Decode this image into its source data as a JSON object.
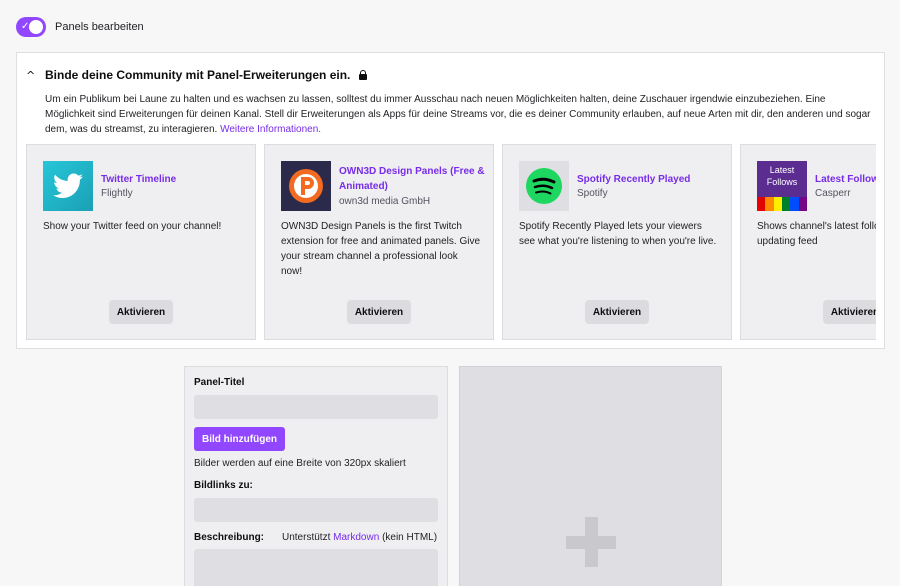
{
  "toggle": {
    "label": "Panels bearbeiten",
    "on": true
  },
  "extensions_box": {
    "title": "Binde deine Community mit Panel-Erweiterungen ein.",
    "description": "Um ein Publikum bei Laune zu halten und es wachsen zu lassen, solltest du immer Ausschau nach neuen Möglichkeiten halten, deine Zuschauer irgendwie einzubeziehen. Eine Möglichkeit sind Erweiterungen für deinen Kanal. Stell dir Erweiterungen als Apps für deine Streams vor, die es deiner Community erlauben, auf neue Arten mit dir, den anderen und sogar dem, was du streamst, zu interagieren.",
    "more_link": "Weitere Informationen.",
    "cards": [
      {
        "name": "Twitter Timeline",
        "developer": "Flightly",
        "description": "Show your Twitter feed on your channel!",
        "button": "Aktivieren",
        "icon": "twitter-bird-icon"
      },
      {
        "name": "OWN3D Design Panels (Free & Animated)",
        "developer": "own3d media GmbH",
        "description": "OWN3D Design Panels is the first Twitch extension for free and animated panels. Give your stream channel a professional look now!",
        "button": "Aktivieren",
        "icon": "own3d-logo-icon"
      },
      {
        "name": "Spotify Recently Played",
        "developer": "Spotify",
        "description": "Spotify Recently Played lets your viewers see what you're listening to when you're live.",
        "button": "Aktivieren",
        "icon": "spotify-icon"
      },
      {
        "name": "Latest Followe",
        "developer": "Casperr",
        "description": "Shows channel's latest follo train in a live updating feed",
        "button": "Aktivieren",
        "icon": "latest-follows-icon",
        "logo_text": "Latest Follows"
      }
    ]
  },
  "editor": {
    "title_label": "Panel-Titel",
    "add_image_button": "Bild hinzufügen",
    "scale_note": "Bilder werden auf eine Breite von 320px skaliert",
    "link_label": "Bildlinks zu:",
    "description_label": "Beschreibung:",
    "markdown_prefix": "Unterstützt",
    "markdown_link": "Markdown",
    "markdown_suffix": "(kein HTML)"
  },
  "add_panel": {
    "icon": "plus-icon"
  },
  "colors": {
    "accent": "#9147ff",
    "link": "#772ce8"
  }
}
